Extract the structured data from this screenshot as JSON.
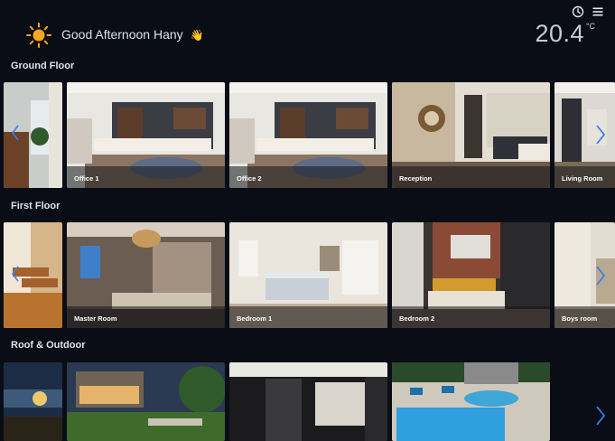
{
  "header": {
    "greeting": "Good Afternoon Hany",
    "wave_emoji": "👋",
    "temperature": "20.4",
    "temperature_unit": "°C"
  },
  "sections": [
    {
      "title": "Ground Floor",
      "rooms": [
        "",
        "Office 1",
        "Office 2",
        "Reception",
        "Living Room"
      ]
    },
    {
      "title": "First Floor",
      "rooms": [
        "",
        "Master Room",
        "Bedroom 1",
        "Bedroom 2",
        "Boys room"
      ]
    },
    {
      "title": "Roof & Outdoor",
      "rooms": [
        "",
        "",
        "",
        ""
      ]
    }
  ],
  "colors": {
    "background": "#0a0d16",
    "accent_blue": "#3d7cf0",
    "sun_yellow": "#f5a623"
  },
  "icons": [
    "sun-icon",
    "clock-icon",
    "menu-icon",
    "chevron-right-icon",
    "chevron-left-icon"
  ]
}
